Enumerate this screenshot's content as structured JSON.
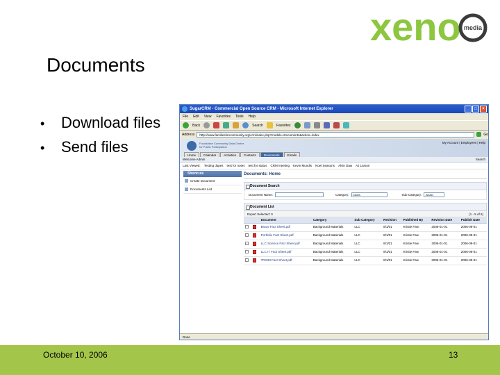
{
  "slide": {
    "title": "Documents",
    "bullets": [
      "Download files",
      "Send files"
    ],
    "footer_date": "October 10, 2006",
    "page_number": "13",
    "logo_text": "xeno",
    "logo_sub": "media"
  },
  "browser": {
    "window_title": "SugarCRM - Commercial Open Source CRM - Microsoft Internet Explorer",
    "menu": [
      "File",
      "Edit",
      "View",
      "Favorites",
      "Tools",
      "Help"
    ],
    "toolbar": {
      "back": "Back",
      "search": "Search",
      "favorites": "Favorites"
    },
    "address_label": "Address",
    "address": "http://www.familiesforcommunity.org/crm/index.php?module=Documents&action=index",
    "go_label": "Go",
    "status": "Done",
    "colors": {
      "titlebar": "#2b5ecf",
      "accent": "#3b6aa8"
    }
  },
  "crm": {
    "tagline": [
      "Foundation Community Data Center",
      "for Public Participation"
    ],
    "account": "My Account | Employees | Help",
    "tabs": [
      "Home",
      "Calendar",
      "Activities",
      "Contacts",
      "Documents",
      "Emails"
    ],
    "active_tab": "Documents",
    "welcome": "Welcome Admin",
    "search_label": "Search",
    "last_viewed_label": "Last Viewed:",
    "last_viewed": [
      "Testing dupes",
      "test for notes",
      "test for status",
      "CRM meeting",
      "Kevin Mundis",
      "Noel Seasons",
      "Alvin Daw",
      "AJ Larson"
    ],
    "shortcuts_title": "Shortcuts",
    "shortcuts": [
      "Create Document",
      "Documents List"
    ],
    "module_title": "Documents: Home",
    "search_section": "Document Search",
    "search_form": {
      "name_label": "Document Name:",
      "category_label": "Category:",
      "category_value": "-None-",
      "subcategory_label": "Sub Category:",
      "subcategory_value": "-None-"
    },
    "list_section": "Document List",
    "list_actions": "Export  Selected: 0",
    "pagination": "(1 - 5 of 5)",
    "columns": [
      "",
      "",
      "Document",
      "Category",
      "Sub Category",
      "Revision",
      "Published By",
      "Revision Date",
      "Publish Date"
    ],
    "rows": [
      {
        "name": "Bravo Fact Sheet.pdf",
        "category": "Background Materials",
        "subcategory": "LLC",
        "revision": "8/1/01",
        "published_by": "Kristie Faw",
        "revision_date": "2006-01-01",
        "publish_date": "2006-09-01"
      },
      {
        "name": "Portfolio Fact Sheet.pdf",
        "category": "Background Materials",
        "subcategory": "LLC",
        "revision": "8/1/01",
        "published_by": "Kristie Faw",
        "revision_date": "2006-01-01",
        "publish_date": "2006-09-01"
      },
      {
        "name": "LLC Science Fact Sheet.pdf",
        "category": "Background Materials",
        "subcategory": "LLC",
        "revision": "8/1/01",
        "published_by": "Kristie Faw",
        "revision_date": "2006-01-01",
        "publish_date": "2006-09-01"
      },
      {
        "name": "LLC IT Fact Sheet.pdf",
        "category": "Background Materials",
        "subcategory": "LLC",
        "revision": "8/1/01",
        "published_by": "Kristie Faw",
        "revision_date": "2006-01-01",
        "publish_date": "2006-09-01"
      },
      {
        "name": "TRIUM Fact Sheet.pdf",
        "category": "Background Materials",
        "subcategory": "LLC",
        "revision": "8/1/01",
        "published_by": "Kristie Faw",
        "revision_date": "2006-01-01",
        "publish_date": "2006-09-01"
      }
    ]
  }
}
